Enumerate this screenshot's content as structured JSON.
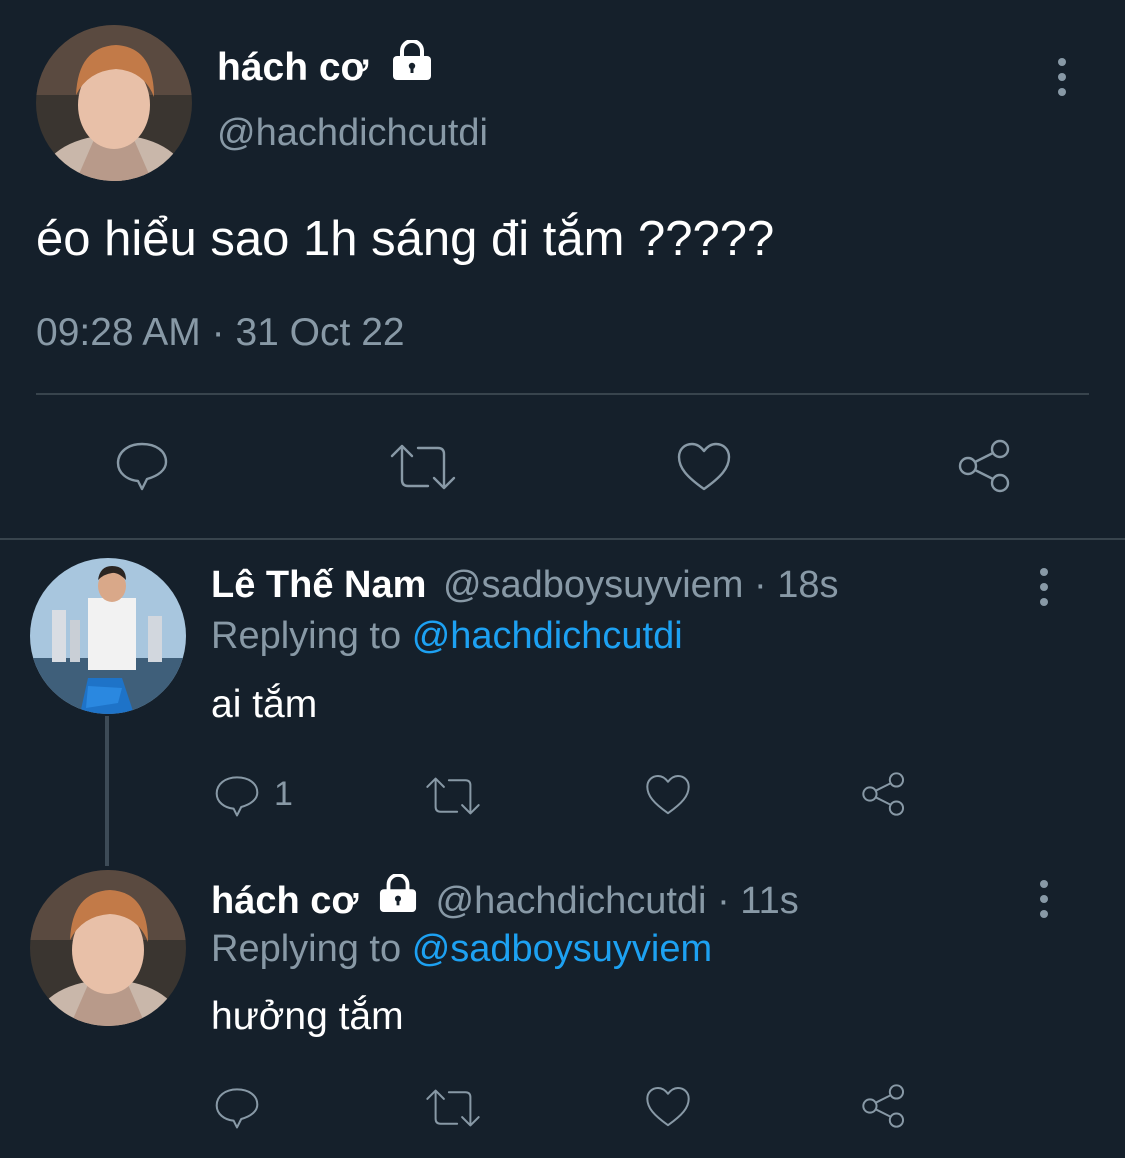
{
  "main_tweet": {
    "display_name": "hách cơ",
    "handle": "@hachdichcutdi",
    "text": "éo hiểu sao 1h sáng đi tắm ?????",
    "time": "09:28 AM",
    "separator": "·",
    "date": "31 Oct 22",
    "locked_icon": "lock-icon",
    "actions": [
      "reply-icon",
      "retweet-icon",
      "like-icon",
      "share-icon"
    ]
  },
  "replies": [
    {
      "display_name": "Lê Thế Nam",
      "handle": "@sadboysuyviem",
      "separator": "·",
      "age": "18s",
      "replying_prefix": "Replying to",
      "replying_to": "@hachdichcutdi",
      "text": "ai tắm",
      "reply_count": "1"
    },
    {
      "display_name": "hách cơ",
      "handle": "@hachdichcutdi",
      "separator": "·",
      "age": "11s",
      "replying_prefix": "Replying to",
      "replying_to": "@sadboysuyviem",
      "text": "hưởng tắm",
      "locked_icon": "lock-icon"
    }
  ],
  "colors": {
    "background": "#15202b",
    "text": "#ffffff",
    "secondary": "#8899a6",
    "link": "#1da1f2",
    "divider": "#38444d"
  }
}
